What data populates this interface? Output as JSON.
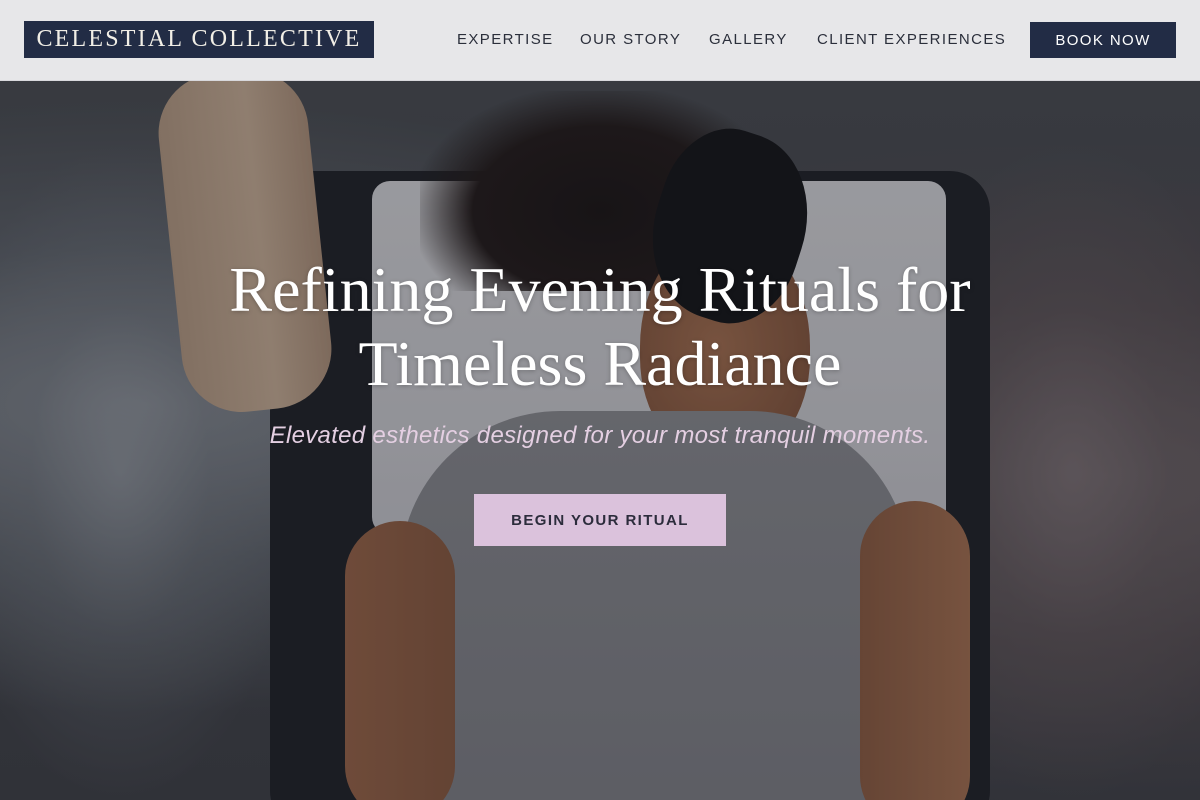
{
  "brand": {
    "logo_text": "CELESTIAL COLLECTIVE"
  },
  "nav": {
    "items": [
      {
        "label": "EXPERTISE"
      },
      {
        "label": "OUR STORY"
      },
      {
        "label": "GALLERY"
      },
      {
        "label": "CLIENT EXPERIENCES"
      }
    ],
    "cta_label": "BOOK NOW"
  },
  "hero": {
    "title_line1": "Refining Evening Rituals for",
    "title_line2": "Timeless Radiance",
    "subtitle": "Elevated esthetics designed for your most tranquil moments.",
    "cta_label": "BEGIN YOUR RITUAL"
  },
  "colors": {
    "navy": "#222c45",
    "lavender": "#dbc2dc",
    "header_bg": "#ececee",
    "subtitle": "#e4cfe2"
  }
}
